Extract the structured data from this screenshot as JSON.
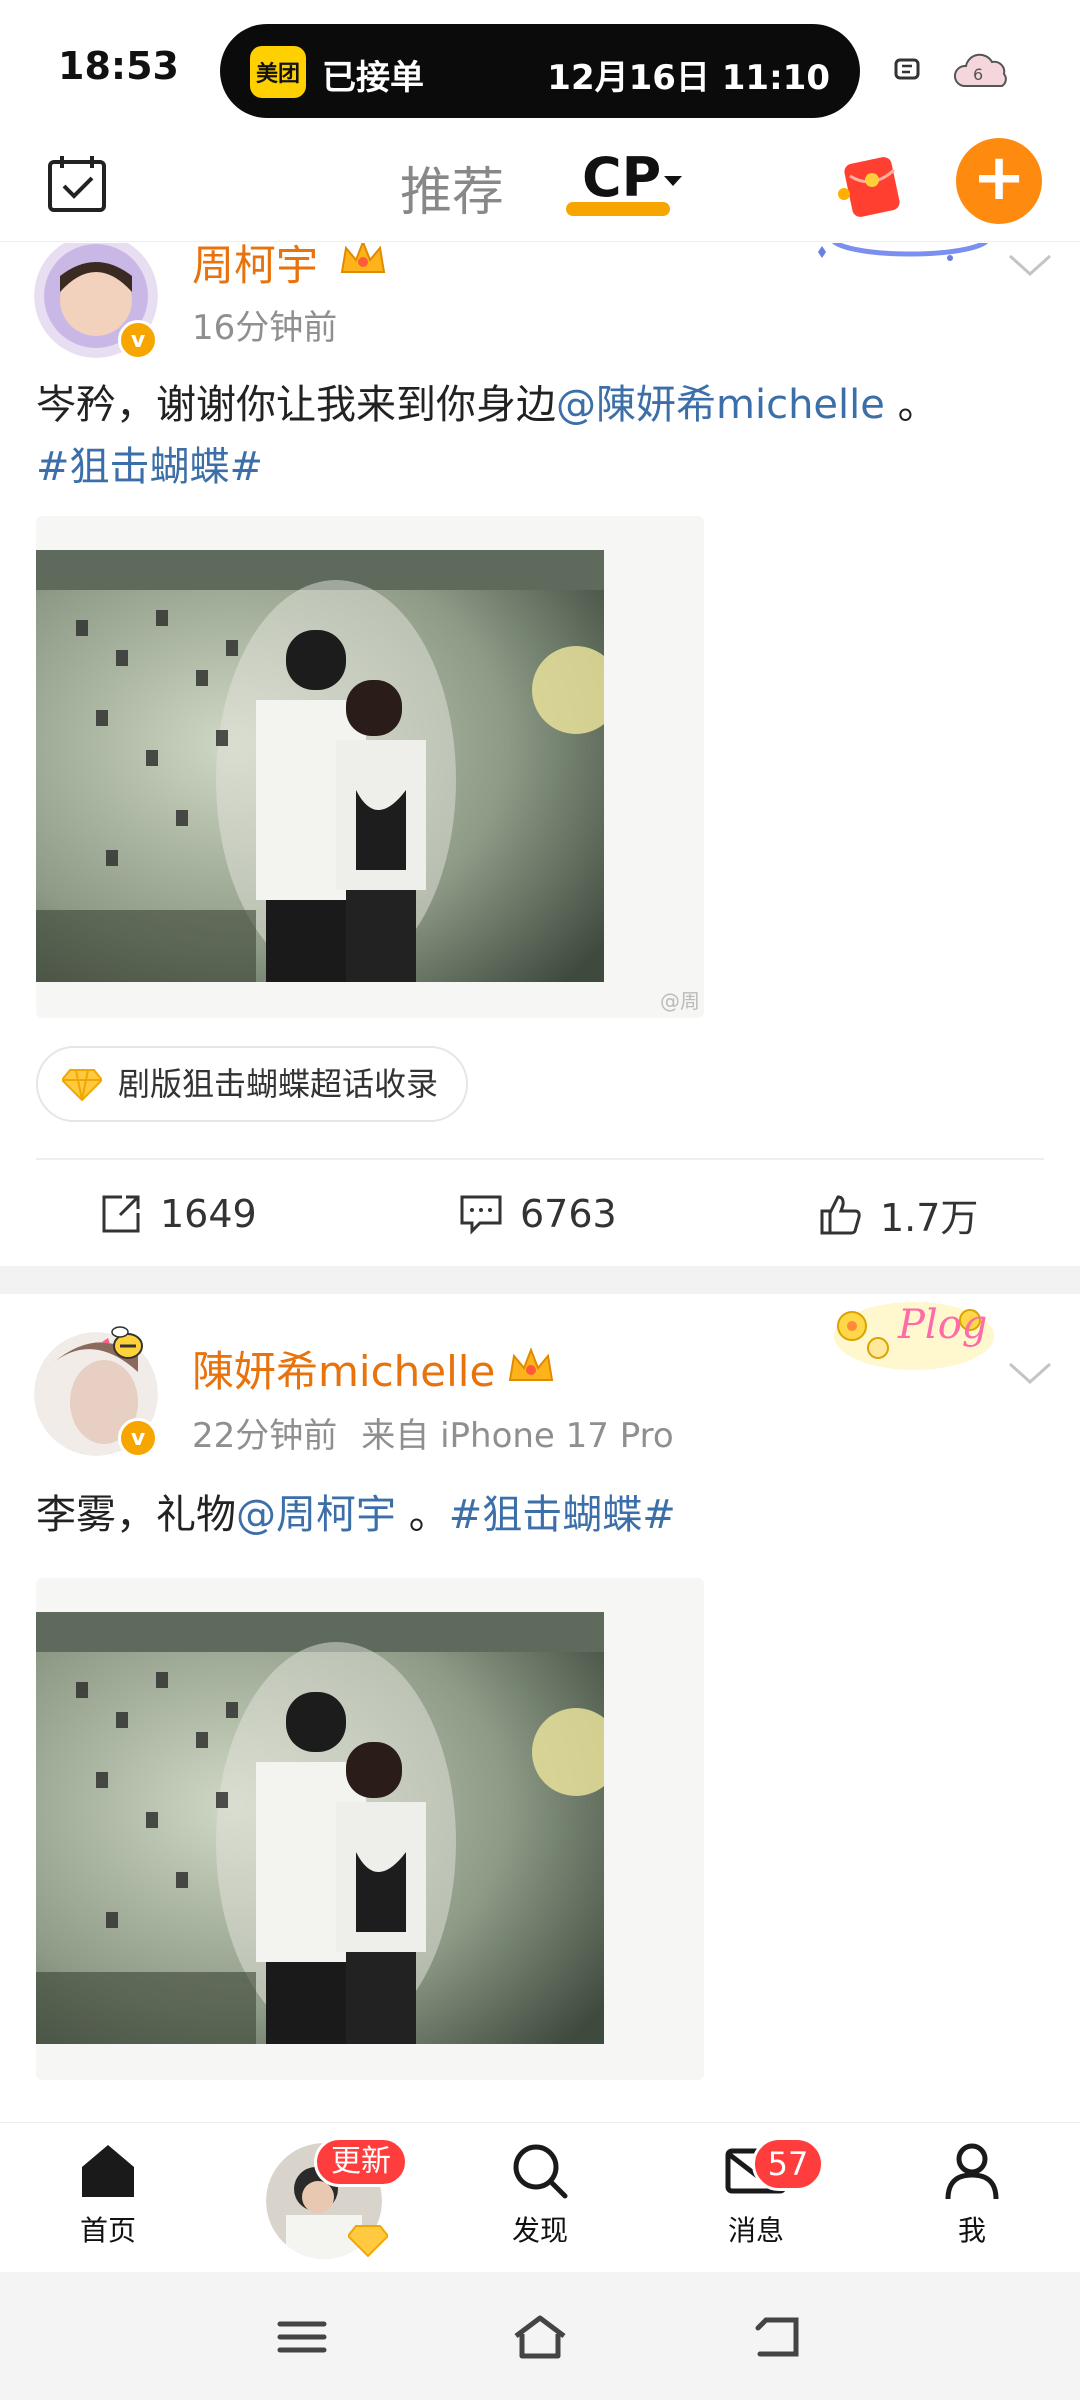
{
  "status_bar": {
    "time": "18:53",
    "island": {
      "app_logo": "美团",
      "status": "已接单",
      "datetime": "12月16日 11:10"
    }
  },
  "header": {
    "tabs": [
      {
        "label": "推荐",
        "active": false
      },
      {
        "label": "CP",
        "active": true
      }
    ],
    "accent_color": "#f7a600"
  },
  "posts": [
    {
      "username": "周柯宇",
      "time": "16分钟前",
      "source": "",
      "text": {
        "prefix": "岑矜，谢谢你让我来到你身边",
        "mention": "@陳妍希michelle",
        "middle": " 。",
        "hashtag": "#狙击蝴蝶#"
      },
      "image_watermark": "@周",
      "topic_chip": "剧版狙击蝴蝶超话收录",
      "actions": {
        "reposts": "1649",
        "comments": "6763",
        "likes": "1.7万"
      }
    },
    {
      "username": "陳妍希michelle",
      "time": "22分钟前",
      "source": "来自 iPhone 17 Pro",
      "text": {
        "prefix": "李雾，礼物",
        "mention": "@周柯宇",
        "middle": " 。",
        "hashtag": "#狙击蝴蝶#"
      },
      "decor_text": "Plog"
    }
  ],
  "bottom_nav": {
    "items": [
      {
        "label": "首页",
        "icon": "home-icon"
      },
      {
        "label": "",
        "icon": "avatar"
      },
      {
        "label": "发现",
        "icon": "search-icon"
      },
      {
        "label": "消息",
        "icon": "mail-icon"
      },
      {
        "label": "我",
        "icon": "profile-icon"
      }
    ],
    "update_badge": "更新",
    "message_count": "57"
  },
  "system_nav": [
    "menu-icon",
    "home-outline-icon",
    "back-icon"
  ]
}
